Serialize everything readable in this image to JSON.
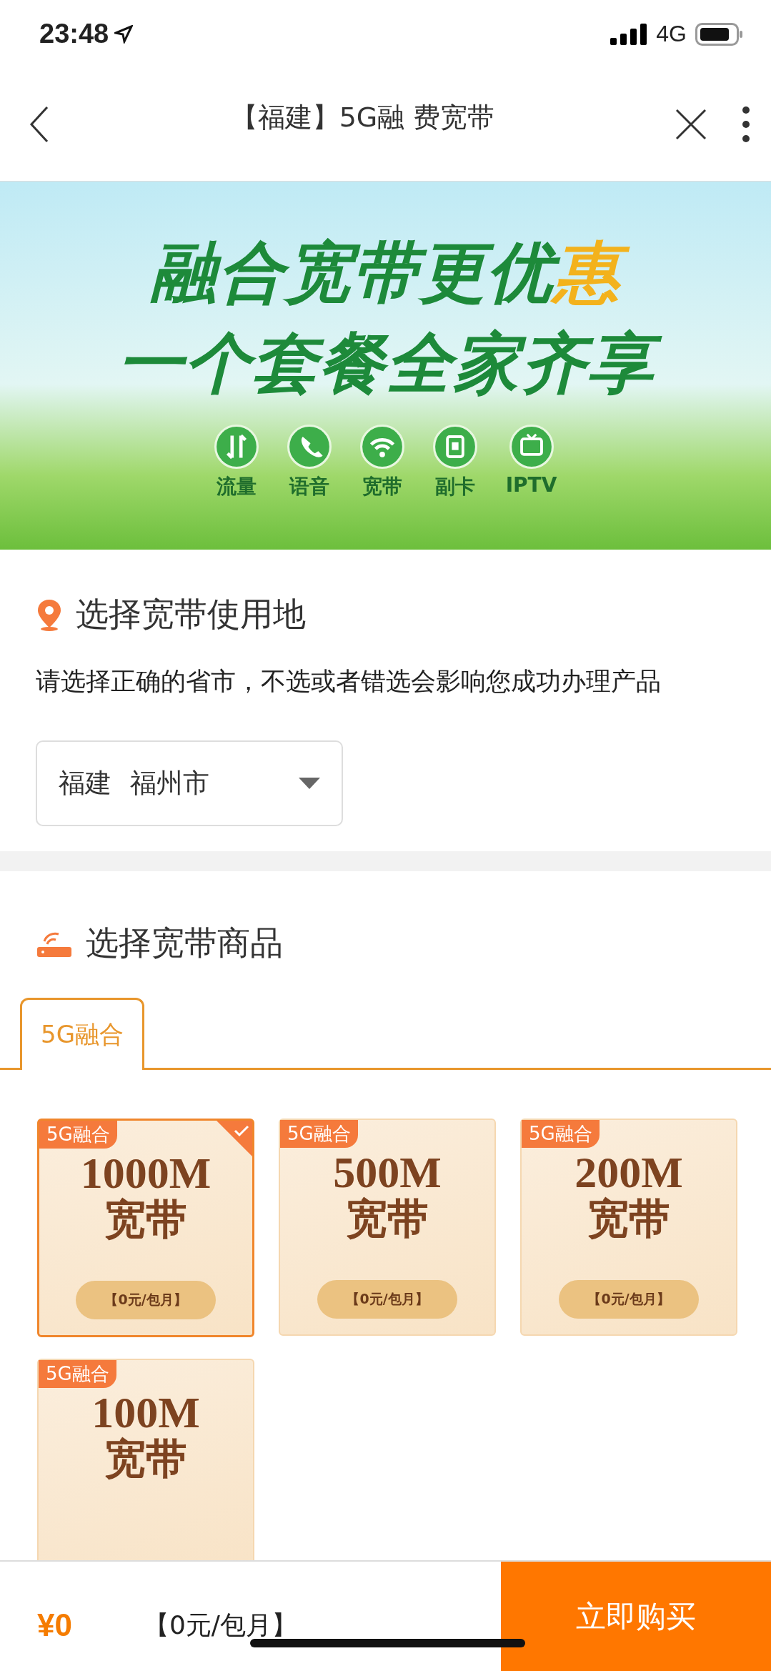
{
  "status_bar": {
    "time": "23:48",
    "network": "4G"
  },
  "nav": {
    "title": "【福建】5G融  费宽带"
  },
  "banner": {
    "headline": [
      "融合宽带更优",
      "惠"
    ],
    "subline": "一个套餐全家齐享",
    "features": [
      {
        "label": "流量",
        "kind": "data"
      },
      {
        "label": "语音",
        "kind": "phone"
      },
      {
        "label": "宽带",
        "kind": "wifi"
      },
      {
        "label": "副卡",
        "kind": "sim"
      },
      {
        "label": "IPTV",
        "kind": "tv"
      }
    ]
  },
  "location": {
    "title": "选择宽带使用地",
    "hint": "请选择正确的省市，不选或者错选会影响您成功办理产品",
    "province": "福建",
    "city": "福州市"
  },
  "products": {
    "title": "选择宽带商品",
    "tabs": [
      {
        "label": "5G融合",
        "selected": true
      }
    ],
    "cards": [
      {
        "tag": "5G融合",
        "speed": "1000M",
        "name": "宽带",
        "price": "【0元/包月】",
        "selected": true
      },
      {
        "tag": "5G融合",
        "speed": "500M",
        "name": "宽带",
        "price": "【0元/包月】",
        "selected": false
      },
      {
        "tag": "5G融合",
        "speed": "200M",
        "name": "宽带",
        "price": "【0元/包月】",
        "selected": false
      },
      {
        "tag": "5G融合",
        "speed": "100M",
        "name": "宽带",
        "selected": false
      }
    ]
  },
  "bottom_bar": {
    "total": "¥0",
    "price": "【0元/包月】",
    "buy": "立即购买"
  }
}
